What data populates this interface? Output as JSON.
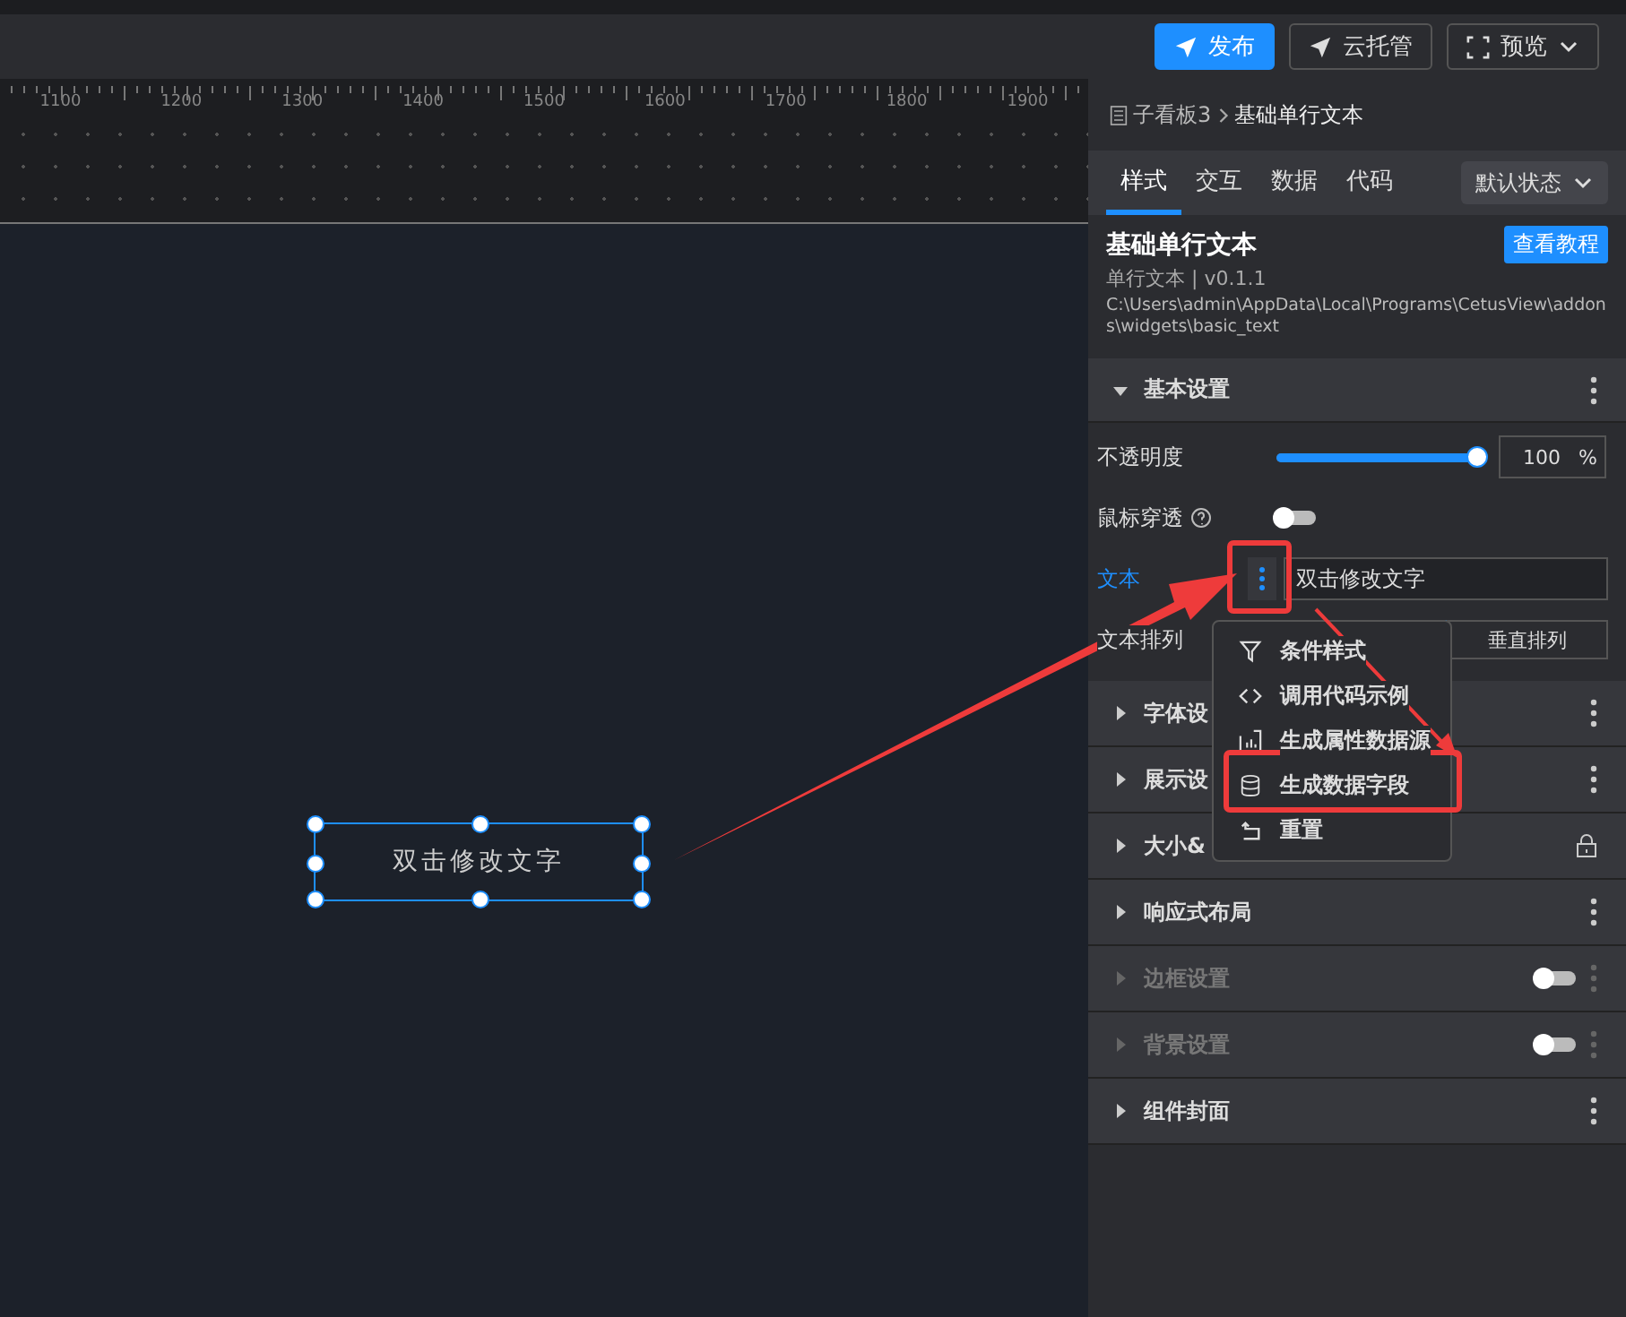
{
  "toolbar": {
    "buttons": [
      {
        "label": "发布",
        "kind": "primary"
      },
      {
        "label": "云托管",
        "kind": "outline"
      },
      {
        "label": "预览",
        "kind": "dropdown"
      }
    ]
  },
  "ruler": {
    "labels": [
      "1100",
      "1200",
      "1300",
      "1400",
      "1500",
      "1600",
      "1700",
      "1800",
      "1900"
    ]
  },
  "canvas": {
    "element_text": "双击修改文字"
  },
  "panel": {
    "breadcrumb": [
      "子看板3",
      "基础单行文本"
    ],
    "tabs": [
      {
        "label": "样式",
        "selected": true
      },
      {
        "label": "交互",
        "selected": false
      },
      {
        "label": "数据",
        "selected": false
      },
      {
        "label": "代码",
        "selected": false
      }
    ],
    "state_select": "默认状态",
    "component": {
      "title": "基础单行文本",
      "tutorial_button": "查看教程",
      "subtitle": "单行文本 | v0.1.1",
      "path": "C:\\Users\\admin\\AppData\\Local\\Programs\\CetusView\\addons\\widgets\\basic_text"
    },
    "basic": {
      "title": "基本设置",
      "expanded": true,
      "opacity": {
        "label": "不透明度",
        "level": 1,
        "value": "100",
        "unit": "%"
      },
      "passthrough": {
        "label": "鼠标穿透",
        "on": false
      },
      "text": {
        "label": "文本",
        "value": "双击修改文字"
      },
      "arrange": {
        "label": "文本排列",
        "option": "垂直排列"
      }
    },
    "sections": [
      {
        "title": "字体设",
        "kind": "dots",
        "disabled": false
      },
      {
        "title": "展示设",
        "kind": "dots",
        "disabled": false
      },
      {
        "title": "大小&",
        "kind": "lock",
        "disabled": false
      },
      {
        "title": "响应式布局",
        "kind": "dots",
        "disabled": false
      },
      {
        "title": "边框设置",
        "kind": "toggle",
        "disabled": true,
        "on": false
      },
      {
        "title": "背景设置",
        "kind": "toggle",
        "disabled": true,
        "on": false
      },
      {
        "title": "组件封面",
        "kind": "dots",
        "disabled": false
      }
    ]
  },
  "menu": {
    "items": [
      {
        "label": "条件样式"
      },
      {
        "label": "调用代码示例"
      },
      {
        "label": "生成属性数据源"
      },
      {
        "label": "生成数据字段"
      },
      {
        "label": "重置"
      }
    ]
  }
}
